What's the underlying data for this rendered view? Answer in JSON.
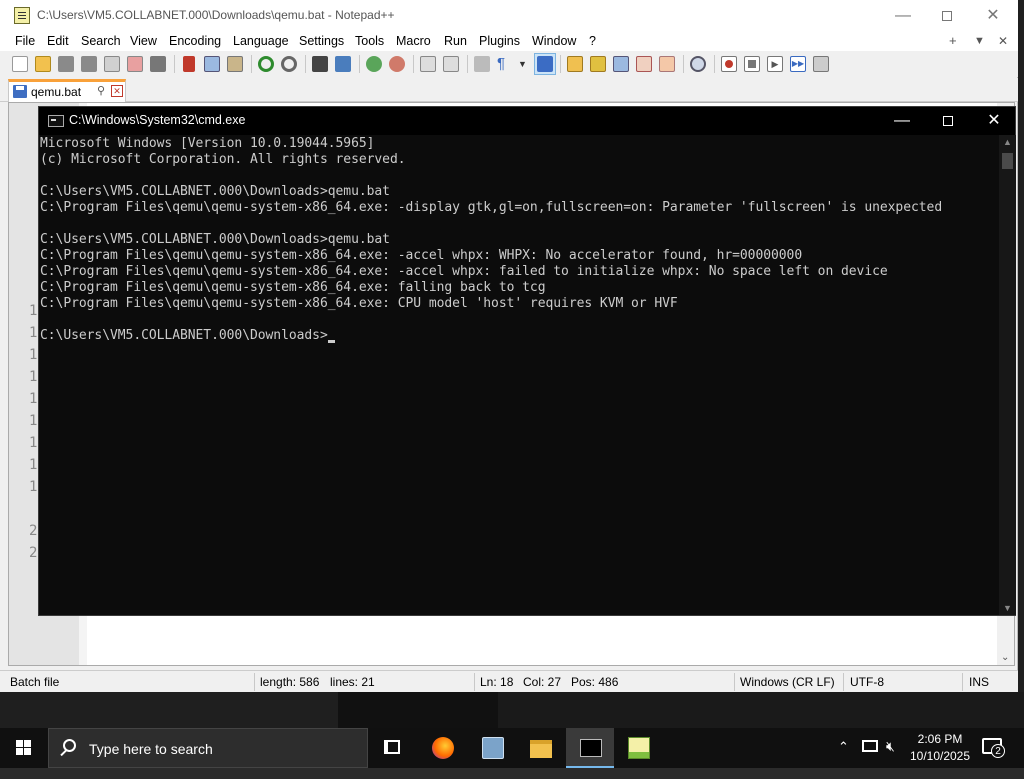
{
  "npp": {
    "title": "C:\\Users\\VM5.COLLABNET.000\\Downloads\\qemu.bat - Notepad++",
    "window_controls": {
      "minimize": "—",
      "close": "✕"
    },
    "menu": [
      "File",
      "Edit",
      "Search",
      "View",
      "Encoding",
      "Language",
      "Settings",
      "Tools",
      "Macro",
      "Run",
      "Plugins",
      "Window",
      "?"
    ],
    "menu_right": {
      "plus": "+",
      "down": "▼",
      "close": "✕"
    },
    "tab": {
      "label": "qemu.bat",
      "pin": "⚲",
      "close": "✕"
    },
    "line_numbers": [
      "1",
      "1",
      "1",
      "1",
      "1",
      "1",
      "1",
      "1",
      "1",
      "2",
      "2"
    ],
    "status": {
      "file_type": "Batch file",
      "length": "length: 586",
      "lines": "lines: 21",
      "ln": "Ln: 18",
      "col": "Col: 27",
      "pos": "Pos: 486",
      "eol": "Windows (CR LF)",
      "encoding": "UTF-8",
      "mode": "INS"
    }
  },
  "cmd": {
    "title": "C:\\Windows\\System32\\cmd.exe",
    "window_controls": {
      "minimize": "—",
      "close": "✕"
    },
    "lines": [
      "Microsoft Windows [Version 10.0.19044.5965]",
      "(c) Microsoft Corporation. All rights reserved.",
      "",
      "C:\\Users\\VM5.COLLABNET.000\\Downloads>qemu.bat",
      "C:\\Program Files\\qemu\\qemu-system-x86_64.exe: -display gtk,gl=on,fullscreen=on: Parameter 'fullscreen' is unexpected",
      "",
      "C:\\Users\\VM5.COLLABNET.000\\Downloads>qemu.bat",
      "C:\\Program Files\\qemu\\qemu-system-x86_64.exe: -accel whpx: WHPX: No accelerator found, hr=00000000",
      "C:\\Program Files\\qemu\\qemu-system-x86_64.exe: -accel whpx: failed to initialize whpx: No space left on device",
      "C:\\Program Files\\qemu\\qemu-system-x86_64.exe: falling back to tcg",
      "C:\\Program Files\\qemu\\qemu-system-x86_64.exe: CPU model 'host' requires KVM or HVF",
      ""
    ],
    "prompt": "C:\\Users\\VM5.COLLABNET.000\\Downloads>"
  },
  "taskbar": {
    "search_placeholder": "Type here to search",
    "time": "2:06 PM",
    "date": "10/10/2025",
    "notification_count": "2"
  }
}
